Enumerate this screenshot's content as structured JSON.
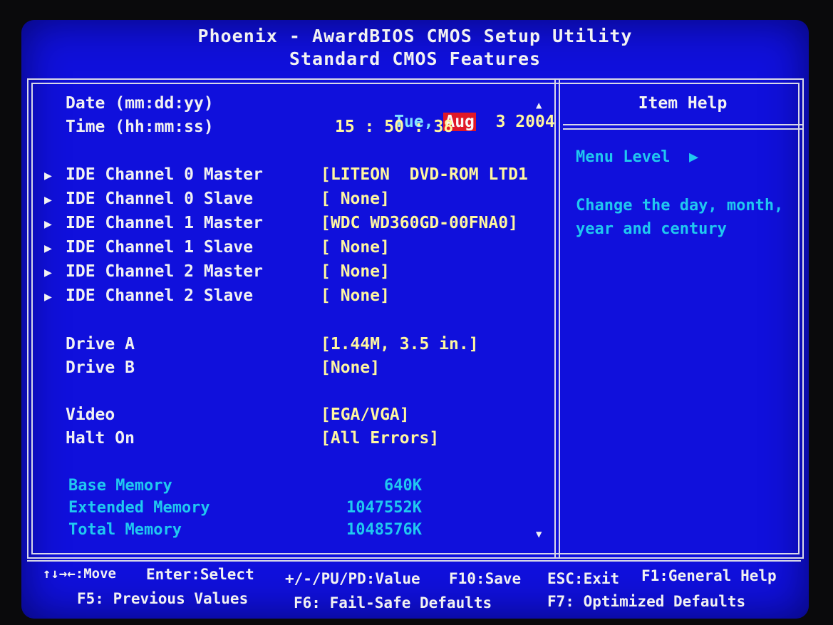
{
  "header": {
    "title": "Phoenix - AwardBIOS CMOS Setup Utility",
    "subtitle": "Standard CMOS Features"
  },
  "settings": {
    "date_label": "Date (mm:dd:yy)",
    "date_day": "Tue,",
    "date_month": "Aug",
    "date_rest": "3 2004",
    "time_label": "Time (hh:mm:ss)",
    "time_value": "15 : 50 : 38",
    "ide": [
      {
        "label": "IDE Channel 0 Master",
        "value": "[LITEON  DVD-ROM LTD1"
      },
      {
        "label": "IDE Channel 0 Slave",
        "value": "[ None]"
      },
      {
        "label": "IDE Channel 1 Master",
        "value": "[WDC WD360GD-00FNA0]"
      },
      {
        "label": "IDE Channel 1 Slave",
        "value": "[ None]"
      },
      {
        "label": "IDE Channel 2 Master",
        "value": "[ None]"
      },
      {
        "label": "IDE Channel 2 Slave",
        "value": "[ None]"
      }
    ],
    "drive_a_label": "Drive A",
    "drive_a_value": "[1.44M, 3.5 in.]",
    "drive_b_label": "Drive B",
    "drive_b_value": "[None]",
    "video_label": "Video",
    "video_value": "[EGA/VGA]",
    "halt_label": "Halt On",
    "halt_value": "[All Errors]",
    "base_mem_label": "Base Memory",
    "base_mem_value": "640K",
    "ext_mem_label": "Extended Memory",
    "ext_mem_value": "1047552K",
    "total_mem_label": "Total Memory",
    "total_mem_value": "1048576K"
  },
  "help": {
    "title": "Item Help",
    "menu_level": "Menu Level",
    "menu_level_arrow": "▶",
    "text_line1": "Change the day, month,",
    "text_line2": "year and century"
  },
  "footer": {
    "move": "↑↓→←:Move",
    "select": "Enter:Select",
    "value": "+/-/PU/PD:Value",
    "save": "F10:Save",
    "exit": "ESC:Exit",
    "help": "F1:General Help",
    "prev": "F5: Previous Values",
    "failsafe": "F6: Fail-Safe Defaults",
    "optimized": "F7: Optimized Defaults"
  },
  "icons": {
    "submenu": "▶",
    "scroll_up": "▲",
    "scroll_down": "▼"
  },
  "colors": {
    "background": "#1010dc",
    "text": "#f2f2f2",
    "value": "#fff7a0",
    "info": "#20c8f0",
    "highlight": "#e01828"
  }
}
